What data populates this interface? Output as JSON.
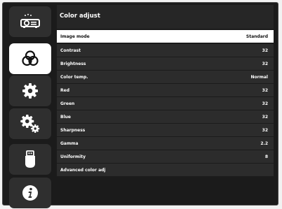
{
  "header": {
    "title": "Color adjust"
  },
  "sidebar": {
    "items": [
      {
        "icon": "projector-icon",
        "active": false
      },
      {
        "icon": "color-palette-icon",
        "active": true
      },
      {
        "icon": "gear-icon",
        "active": false
      },
      {
        "icon": "advanced-gear-icon",
        "active": false
      },
      {
        "icon": "usb-icon",
        "active": false
      },
      {
        "icon": "info-icon",
        "active": false
      }
    ]
  },
  "menu": {
    "items": [
      {
        "label": "Image mode",
        "value": "Standard",
        "selected": true
      },
      {
        "label": "Contrast",
        "value": "32"
      },
      {
        "label": "Brightness",
        "value": "32"
      },
      {
        "label": "Color temp.",
        "value": "Normal"
      },
      {
        "label": "Red",
        "value": "32"
      },
      {
        "label": "Green",
        "value": "32"
      },
      {
        "label": "Blue",
        "value": "32"
      },
      {
        "label": "Sharpness",
        "value": "32"
      },
      {
        "label": "Gamma",
        "value": "2.2"
      },
      {
        "label": "Uniformity",
        "value": "8"
      },
      {
        "label": "Advanced color adj",
        "value": ""
      }
    ]
  },
  "colors": {
    "background": "#1b1b1b",
    "panel": "#2c2c2c",
    "selected": "#ffffff"
  }
}
